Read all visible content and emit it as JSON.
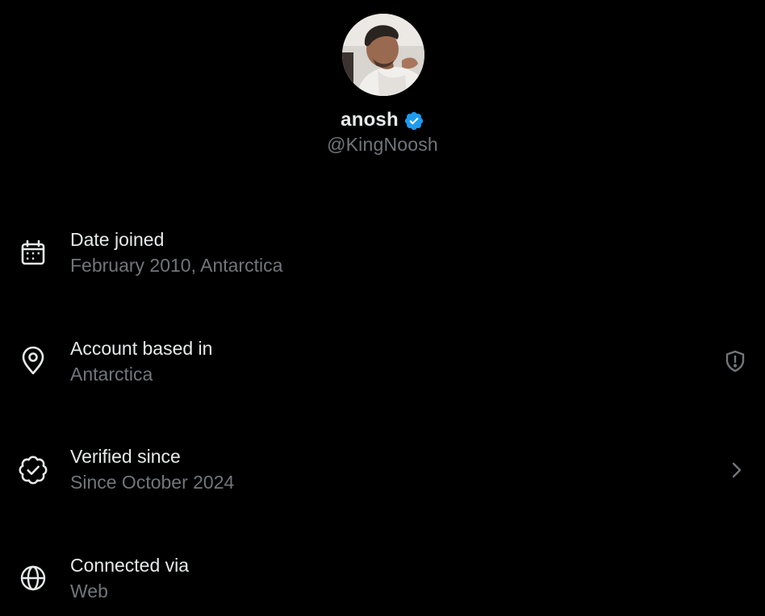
{
  "profile": {
    "display_name": "anosh",
    "handle": "@KingNoosh",
    "verified": true,
    "badge_color": "#1d9bf0"
  },
  "rows": [
    {
      "title": "Date joined",
      "value": "February 2010, Antarctica",
      "icon": "calendar-icon"
    },
    {
      "title": "Account based in",
      "value": "Antarctica",
      "icon": "location-pin-icon",
      "trailing_icon": "shield-alert-icon"
    },
    {
      "title": "Verified since",
      "value": "Since October 2024",
      "icon": "verified-check-icon",
      "trailing_icon": "chevron-right-icon"
    },
    {
      "title": "Connected via",
      "value": "Web",
      "icon": "globe-icon"
    }
  ],
  "colors": {
    "background": "#000000",
    "primary_text": "#e7e9ea",
    "secondary_text": "#71767b",
    "accent": "#1d9bf0"
  }
}
